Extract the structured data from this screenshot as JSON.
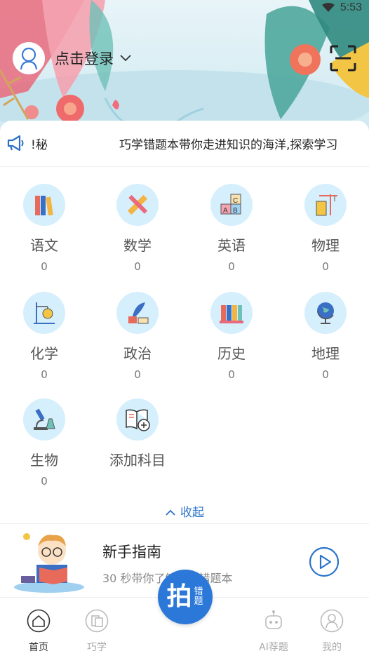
{
  "status_bar": {
    "time": "5:53"
  },
  "header": {
    "login_label": "点击登录"
  },
  "notice": {
    "left_text": "!秘",
    "scroll_text": "巧学错题本带你走进知识的海洋,探索学习"
  },
  "subjects": [
    {
      "name": "语文",
      "count": "0",
      "icon": "books-icon"
    },
    {
      "name": "数学",
      "count": "0",
      "icon": "ruler-pencil-icon"
    },
    {
      "name": "英语",
      "count": "0",
      "icon": "abc-blocks-icon"
    },
    {
      "name": "物理",
      "count": "0",
      "icon": "crane-building-icon"
    },
    {
      "name": "化学",
      "count": "0",
      "icon": "flask-stand-icon"
    },
    {
      "name": "政治",
      "count": "0",
      "icon": "quill-ink-icon"
    },
    {
      "name": "历史",
      "count": "0",
      "icon": "history-books-icon"
    },
    {
      "name": "地理",
      "count": "0",
      "icon": "globe-icon"
    },
    {
      "name": "生物",
      "count": "0",
      "icon": "microscope-icon"
    }
  ],
  "add_subject_label": "添加科目",
  "collapse_label": "收起",
  "guide": {
    "title": "新手指南",
    "subtitle": "30 秒带你了解巧学错题本"
  },
  "nav": {
    "home": "首页",
    "study": "巧学",
    "photo_big": "拍",
    "photo_small": "错题",
    "ai": "AI荐题",
    "mine": "我的"
  },
  "colors": {
    "accent": "#2b78d8",
    "icon_bg": "#d6effd",
    "link": "#2a73c9"
  }
}
